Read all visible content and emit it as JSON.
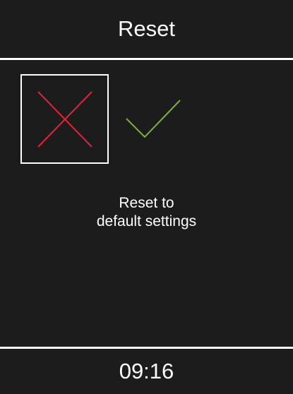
{
  "screen": {
    "title": "Reset",
    "message_line1": "Reset to",
    "message_line2": "default settings",
    "time": "09:16"
  },
  "options": {
    "cancel_icon": "cross-icon",
    "confirm_icon": "checkmark-icon",
    "selected": "cancel"
  },
  "colors": {
    "background": "#1c1c1c",
    "text": "#ffffff",
    "cancel": "#e02434",
    "confirm": "#7fae3e",
    "selection_border": "#ffffff"
  }
}
